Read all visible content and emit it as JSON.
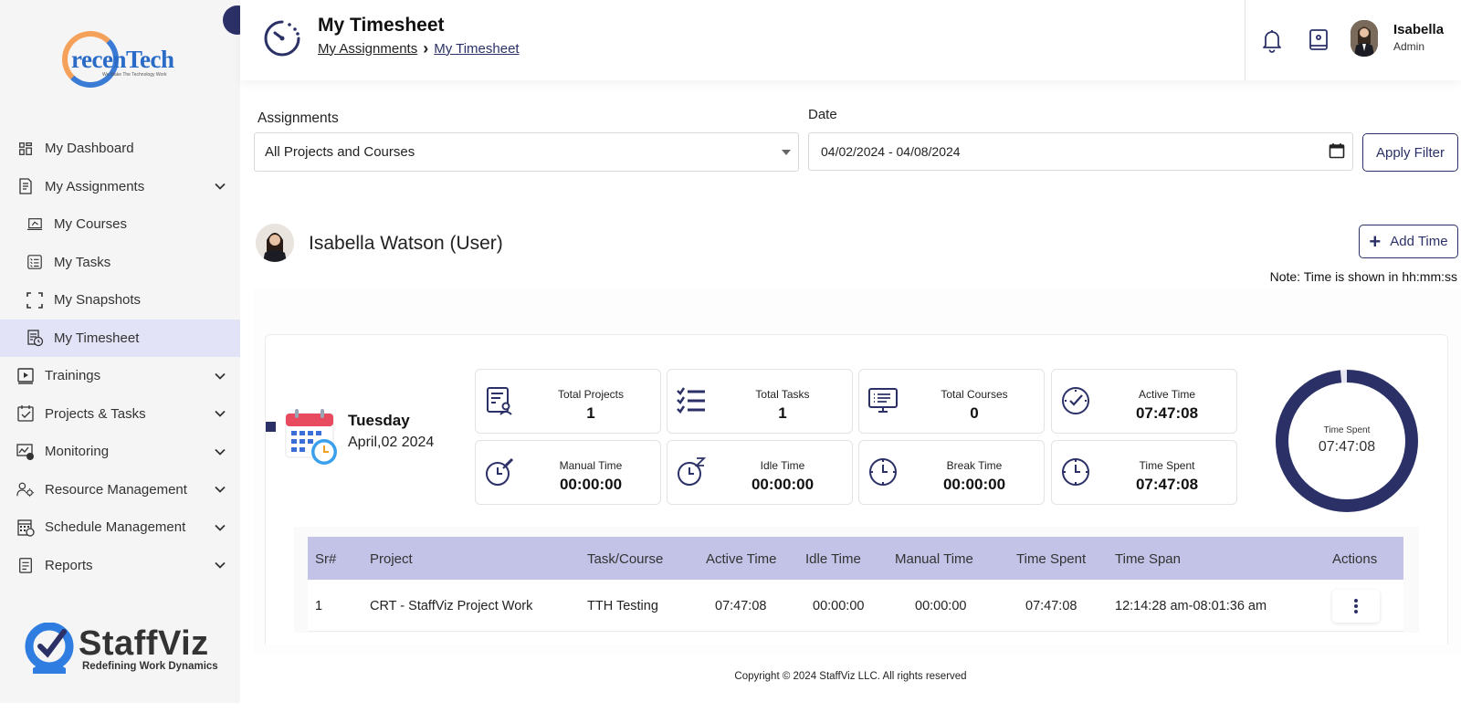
{
  "brand": {
    "company_logo_text": "recenTech",
    "company_logo_tagline": "We Make The Technology Work",
    "product_name": "StaffViz",
    "product_tagline": "Redefining Work Dynamics"
  },
  "sidebar": {
    "items": [
      {
        "label": "My Dashboard",
        "icon": "dashboard-icon",
        "sub": false,
        "chevron": false,
        "active": false
      },
      {
        "label": "My Assignments",
        "icon": "assignments-icon",
        "sub": false,
        "chevron": true,
        "active": false
      },
      {
        "label": "My Courses",
        "icon": "courses-icon",
        "sub": true,
        "chevron": false,
        "active": false
      },
      {
        "label": "My Tasks",
        "icon": "tasks-icon",
        "sub": true,
        "chevron": false,
        "active": false
      },
      {
        "label": "My Snapshots",
        "icon": "snapshots-icon",
        "sub": true,
        "chevron": false,
        "active": false
      },
      {
        "label": "My Timesheet",
        "icon": "timesheet-icon",
        "sub": true,
        "chevron": false,
        "active": true
      },
      {
        "label": "Trainings",
        "icon": "trainings-icon",
        "sub": false,
        "chevron": true,
        "active": false
      },
      {
        "label": "Projects & Tasks",
        "icon": "projects-icon",
        "sub": false,
        "chevron": true,
        "active": false
      },
      {
        "label": "Monitoring",
        "icon": "monitoring-icon",
        "sub": false,
        "chevron": true,
        "active": false
      },
      {
        "label": "Resource Management",
        "icon": "resource-icon",
        "sub": false,
        "chevron": true,
        "active": false
      },
      {
        "label": "Schedule Management",
        "icon": "schedule-icon",
        "sub": false,
        "chevron": true,
        "active": false
      },
      {
        "label": "Reports",
        "icon": "reports-icon",
        "sub": false,
        "chevron": true,
        "active": false
      }
    ]
  },
  "header": {
    "title": "My Timesheet",
    "breadcrumb": {
      "parent": "My Assignments",
      "separator": "›",
      "current": "My Timesheet"
    },
    "user": {
      "name": "Isabella",
      "role": "Admin"
    }
  },
  "filters": {
    "assignments_label": "Assignments",
    "assignments_value": "All Projects and Courses",
    "date_label": "Date",
    "date_value": "04/02/2024 - 04/08/2024",
    "apply_label": "Apply Filter"
  },
  "user_section": {
    "name": "Isabella Watson (User)",
    "add_time_label": "Add Time",
    "note": "Note: Time is shown in hh:mm:ss"
  },
  "day": {
    "weekday": "Tuesday",
    "date": "April,02 2024",
    "stats": [
      {
        "title": "Total Projects",
        "value": "1",
        "icon": "projects-stat-icon"
      },
      {
        "title": "Total Tasks",
        "value": "1",
        "icon": "tasks-list-icon"
      },
      {
        "title": "Total Courses",
        "value": "0",
        "icon": "courses-monitor-icon"
      },
      {
        "title": "Active Time",
        "value": "07:47:08",
        "icon": "active-time-icon"
      },
      {
        "title": "Manual Time",
        "value": "00:00:00",
        "icon": "manual-time-icon"
      },
      {
        "title": "Idle Time",
        "value": "00:00:00",
        "icon": "idle-time-icon"
      },
      {
        "title": "Break Time",
        "value": "00:00:00",
        "icon": "break-time-icon"
      },
      {
        "title": "Time Spent",
        "value": "07:47:08",
        "icon": "time-spent-icon"
      }
    ],
    "donut": {
      "label": "Time Spent",
      "value": "07:47:08",
      "fill_fraction": 0.985,
      "color": "#2b3167"
    }
  },
  "table": {
    "headers": [
      "Sr#",
      "Project",
      "Task/Course",
      "Active Time",
      "Idle Time",
      "Manual Time",
      "Time Spent",
      "Time Span",
      "Actions"
    ],
    "rows": [
      [
        "1",
        "CRT - StaffViz Project Work",
        "TTH Testing",
        "07:47:08",
        "00:00:00",
        "00:00:00",
        "07:47:08",
        "12:14:28 am-08:01:36 am"
      ]
    ]
  },
  "footer": {
    "copyright": "Copyright © 2024 StaffViz LLC. All rights reserved"
  },
  "colors": {
    "accent": "#2b3167",
    "table_header": "#c3c3e8",
    "active_nav": "#e3e3f7"
  }
}
